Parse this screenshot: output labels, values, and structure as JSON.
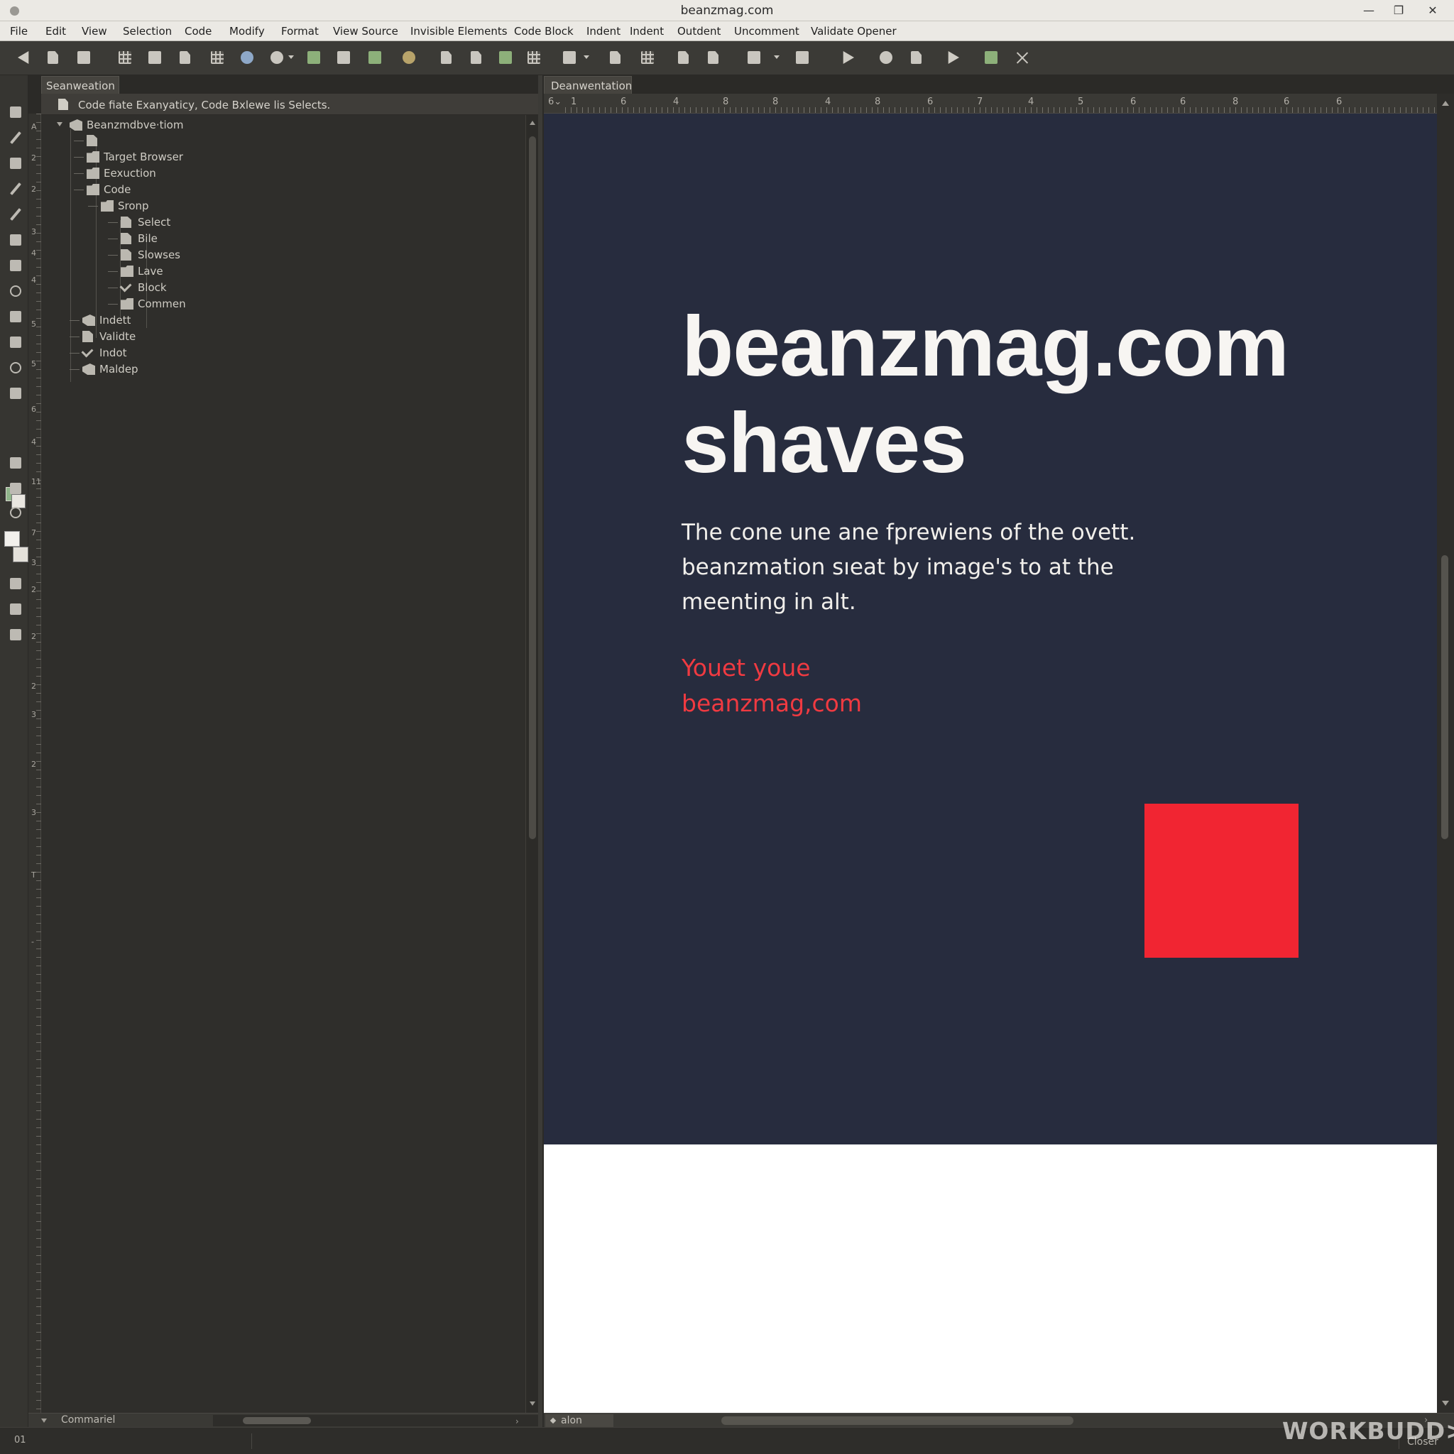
{
  "window": {
    "title": "beanzmag.com",
    "buttons": {
      "minimize": "—",
      "restore": "❐",
      "close": "✕"
    }
  },
  "menu": [
    "File",
    "Edit",
    "View",
    "Selection",
    "Code",
    "Modify",
    "Format",
    "View Source",
    "Invisible Elements",
    "Code Block",
    "Indent",
    "Indent",
    "Outdent",
    "Uncomment",
    "Validate Opener"
  ],
  "toolbar_icons": [
    "back-icon",
    "new-file-icon",
    "save-icon",
    "split-view-icon",
    "layout-icon",
    "insert-icon",
    "table-icon",
    "globe-icon",
    "gear-icon",
    "bug-icon",
    "link-icon",
    "image-icon",
    "refresh-icon",
    "page-icon",
    "document-icon",
    "plugin-icon",
    "grid-icon",
    "snippet-icon",
    "shape-icon",
    "frame-icon",
    "copy-icon",
    "paste-icon",
    "stack-icon",
    "list-icon",
    "run-icon",
    "inspect-icon",
    "chart-icon",
    "flag-icon",
    "export-icon",
    "close-icon"
  ],
  "left_panel": {
    "tab": "Seanweation",
    "header": "Code fiate Exanyaticy, Code Bxlewe lis Selects.",
    "tree": [
      {
        "label": "Beanzmdbve·tiom",
        "icon": "stack"
      },
      {
        "label": "",
        "icon": "page"
      },
      {
        "label": "Target Browser",
        "icon": "folder"
      },
      {
        "label": "Eexuction",
        "icon": "folder"
      },
      {
        "label": "Code",
        "icon": "folder"
      },
      {
        "label": "Sronp",
        "icon": "folder"
      },
      {
        "label": "Select",
        "icon": "page"
      },
      {
        "label": "Bile",
        "icon": "page"
      },
      {
        "label": "Slowses",
        "icon": "page"
      },
      {
        "label": "Lave",
        "icon": "folder"
      },
      {
        "label": "Block",
        "icon": "check"
      },
      {
        "label": "Commen",
        "icon": "folder"
      },
      {
        "label": "Indett",
        "icon": "stack"
      },
      {
        "label": "Validte",
        "icon": "page"
      },
      {
        "label": "Indot",
        "icon": "check"
      },
      {
        "label": "Maldep",
        "icon": "stack"
      }
    ],
    "vertical_ruler": [
      "A",
      "2",
      "2",
      "3",
      "4",
      "4",
      "5",
      "5",
      "6",
      "4",
      "11",
      "7",
      "3",
      "2",
      "2",
      "2",
      "3",
      "2",
      "3",
      "T",
      "-"
    ],
    "bottom_label": "Commariel"
  },
  "right_panel": {
    "tab": "Deanwentation",
    "ruler_corner": "6⌄",
    "ruler_numbers": [
      "1",
      "6",
      "4",
      "8",
      "8",
      "4",
      "8",
      "6",
      "7",
      "4",
      "5",
      "6",
      "6",
      "8",
      "6",
      "6"
    ],
    "bottom_label": "alon"
  },
  "page": {
    "hero_title": [
      "beanzmag.com",
      "shaves"
    ],
    "hero_body": [
      "The cone une ane fprewiens of the ovett.",
      "beanzmation sıeat by image's to at the",
      "meenting in alt."
    ],
    "cta": [
      "Youet youe",
      "beanzmag,com"
    ],
    "colors": {
      "hero_bg": "#272c3e",
      "accent_red": "#f12532",
      "cta_text": "#f03a41"
    }
  },
  "status": {
    "left": "01",
    "right": "Closer"
  },
  "watermark": "WORKBUDD>_"
}
